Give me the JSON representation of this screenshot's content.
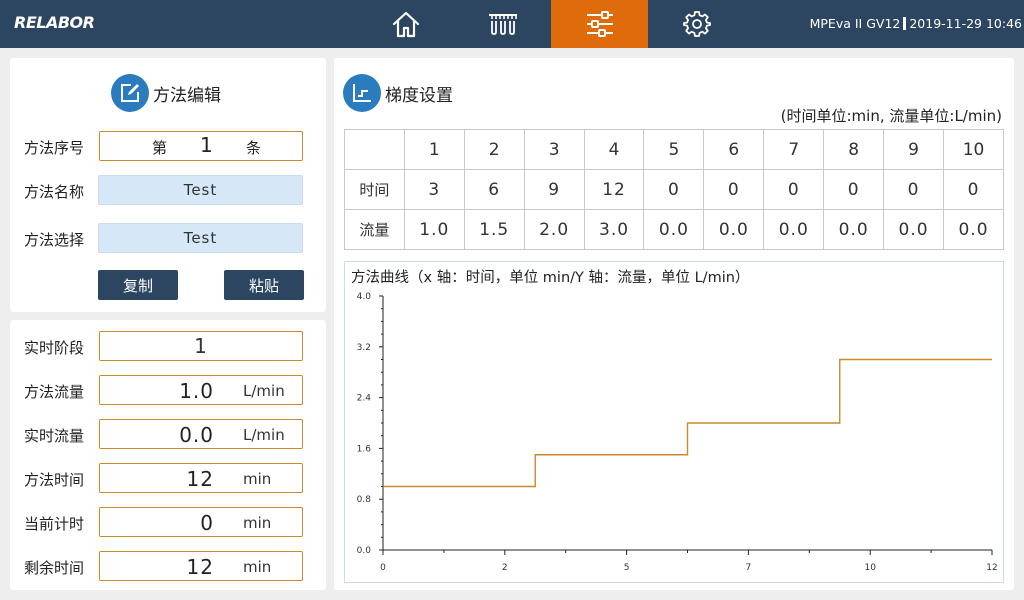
{
  "header": {
    "logo": "RELABOR",
    "device": "MPEva II GV12",
    "datetime": "2019-11-29 10:46",
    "nav": [
      {
        "icon": "home-icon"
      },
      {
        "icon": "instrument-icon"
      },
      {
        "icon": "sliders-icon",
        "active": true
      },
      {
        "icon": "gear-icon"
      }
    ],
    "active_color": "#e06b0b",
    "bar_color": "#2c4560"
  },
  "method_edit": {
    "title": "方法编辑",
    "seq_label": "方法序号",
    "seq_prefix": "第",
    "seq_value": "1",
    "seq_suffix": "条",
    "name_label": "方法名称",
    "name_value": "Test",
    "select_label": "方法选择",
    "select_value": "Test",
    "copy_button": "复制",
    "paste_button": "粘贴"
  },
  "realtime": {
    "stage_label": "实时阶段",
    "stage_value": "1",
    "method_flow_label": "方法流量",
    "method_flow_value": "1.0",
    "method_flow_unit": "L/min",
    "real_flow_label": "实时流量",
    "real_flow_value": "0.0",
    "real_flow_unit": "L/min",
    "method_time_label": "方法时间",
    "method_time_value": "12",
    "method_time_unit": "min",
    "timer_label": "当前计时",
    "timer_value": "0",
    "timer_unit": "min",
    "remain_label": "剩余时间",
    "remain_value": "12",
    "remain_unit": "min"
  },
  "gradient": {
    "title": "梯度设置",
    "unit_note": "(时间单位:min, 流量单位:L/min)",
    "columns": [
      "1",
      "2",
      "3",
      "4",
      "5",
      "6",
      "7",
      "8",
      "9",
      "10"
    ],
    "time_label": "时间",
    "times": [
      "3",
      "6",
      "9",
      "12",
      "0",
      "0",
      "0",
      "0",
      "0",
      "0"
    ],
    "flow_label": "流量",
    "flows": [
      "1.0",
      "1.5",
      "2.0",
      "3.0",
      "0.0",
      "0.0",
      "0.0",
      "0.0",
      "0.0",
      "0.0"
    ]
  },
  "chart_data": {
    "type": "line",
    "title": "方法曲线（x 轴：时间，单位 min/Y 轴：流量，单位 L/min）",
    "x_ticks": [
      "0",
      "2",
      "5",
      "7",
      "10",
      "12"
    ],
    "y_ticks": [
      "0.0",
      "0.8",
      "1.6",
      "2.4",
      "3.2",
      "4.0"
    ],
    "xlim": [
      0,
      12
    ],
    "ylim": [
      0,
      4
    ],
    "step_points": [
      [
        0,
        1.0
      ],
      [
        3,
        1.0
      ],
      [
        3,
        1.5
      ],
      [
        6,
        1.5
      ],
      [
        6,
        2.0
      ],
      [
        9,
        2.0
      ],
      [
        9,
        3.0
      ],
      [
        12,
        3.0
      ]
    ],
    "line_color": "#c98a2c"
  }
}
